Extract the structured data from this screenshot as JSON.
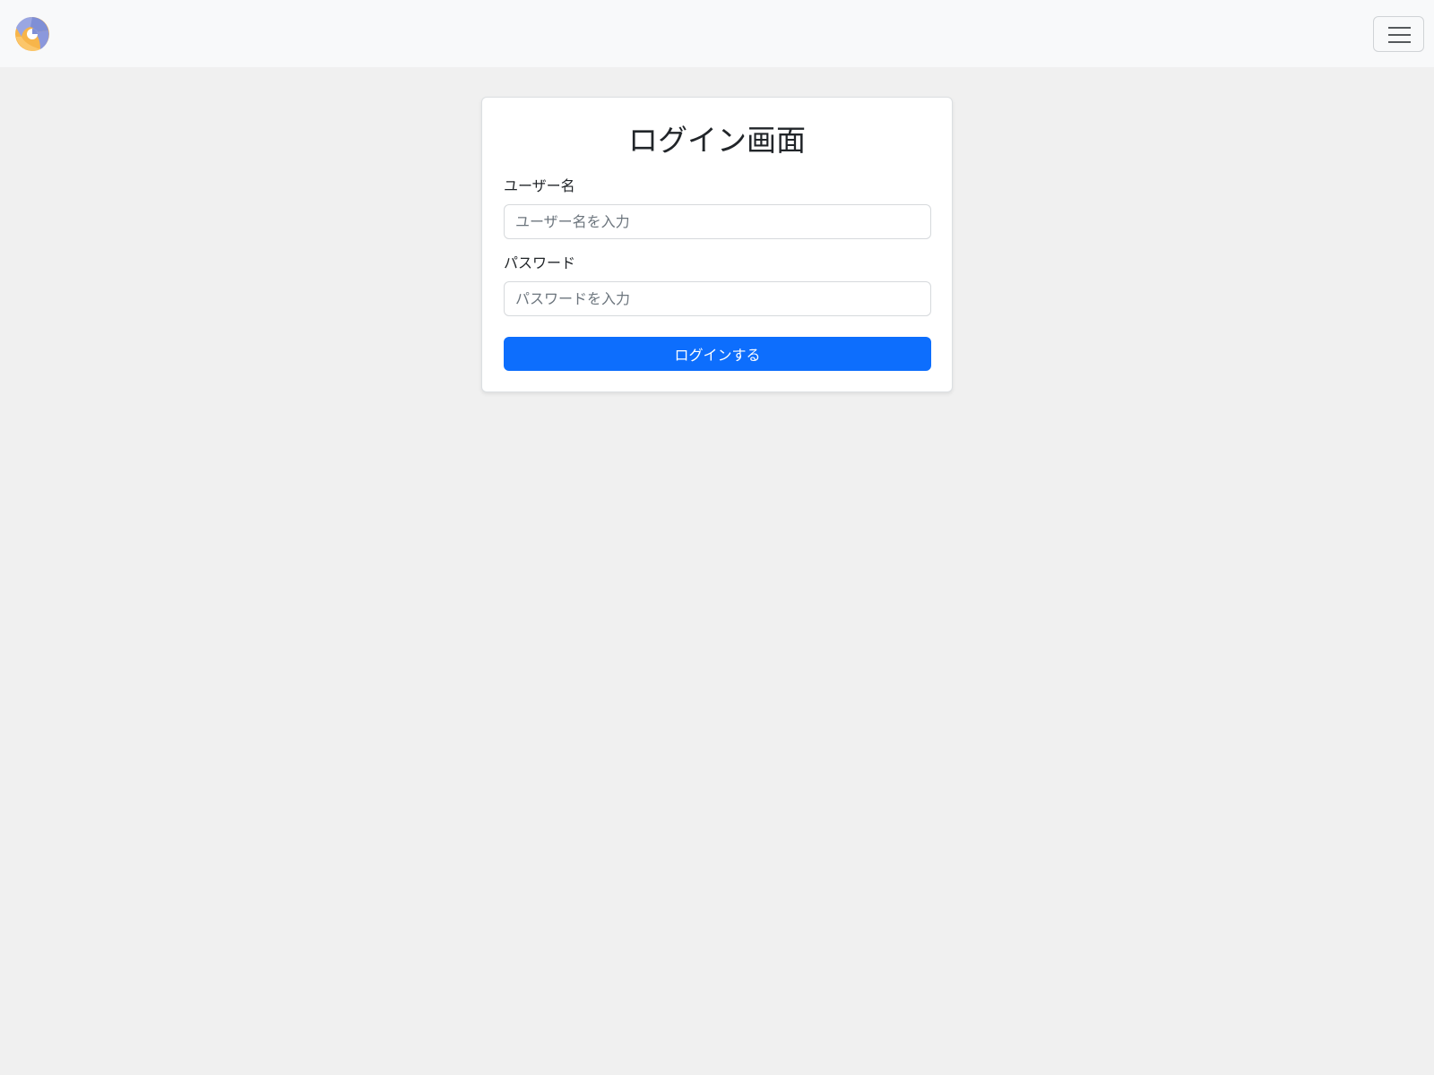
{
  "navbar": {
    "logo_icon": "volleyball-logo-icon",
    "menu_icon": "hamburger-menu-icon",
    "colors": {
      "background": "#f8f9fa",
      "logo_blue": "#7f8fd6",
      "logo_orange": "#f7b54a"
    }
  },
  "login": {
    "title": "ログイン画面",
    "username": {
      "label": "ユーザー名",
      "value": "",
      "placeholder": "ユーザー名を入力"
    },
    "password": {
      "label": "パスワード",
      "value": "",
      "placeholder": "パスワードを入力"
    },
    "submit_label": "ログインする",
    "colors": {
      "primary": "#0d6efd",
      "page_background": "#f0f0f0"
    }
  }
}
